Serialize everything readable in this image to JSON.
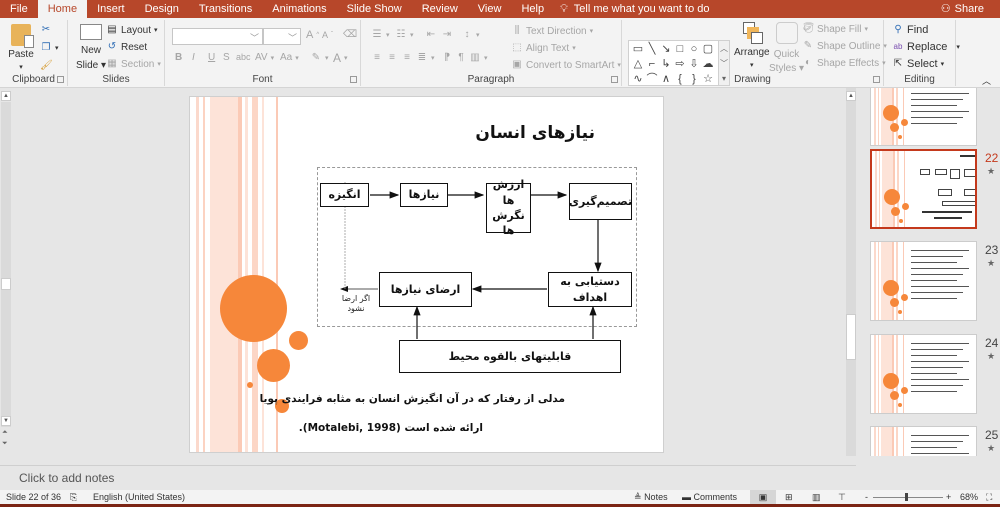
{
  "tabs": [
    "File",
    "Home",
    "Insert",
    "Design",
    "Transitions",
    "Animations",
    "Slide Show",
    "Review",
    "View",
    "Help"
  ],
  "active_tab": "Home",
  "tell_me": "Tell me what you want to do",
  "share": "Share",
  "ribbon": {
    "clipboard": {
      "label": "Clipboard",
      "paste": "Paste"
    },
    "slides": {
      "label": "Slides",
      "new_slide_1": "New",
      "new_slide_2": "Slide",
      "layout": "Layout",
      "reset": "Reset",
      "section": "Section"
    },
    "font": {
      "label": "Font",
      "font_name": "",
      "font_size": "",
      "bold": "B",
      "italic": "I",
      "underline": "U",
      "strike": "S",
      "abc": "abc",
      "spacing": "AV",
      "case": "Aa",
      "grow": "A",
      "shrink": "A",
      "color": "A"
    },
    "paragraph": {
      "label": "Paragraph",
      "text_direction": "Text Direction",
      "align_text": "Align Text",
      "convert_smartart": "Convert to SmartArt"
    },
    "drawing": {
      "label": "Drawing",
      "arrange": "Arrange",
      "quick_styles_1": "Quick",
      "quick_styles_2": "Styles",
      "shape_fill": "Shape Fill",
      "shape_outline": "Shape Outline",
      "shape_effects": "Shape Effects",
      "shapes": [
        "▭",
        "╲",
        "↘",
        "□",
        "○",
        "▢",
        "△",
        "⌐",
        "↳",
        "⇨",
        "⇩",
        "☁",
        "∿",
        "⌒",
        "∧",
        "{",
        "}",
        "☆"
      ]
    },
    "editing": {
      "label": "Editing",
      "find": "Find",
      "replace": "Replace",
      "select": "Select"
    }
  },
  "slide": {
    "title": "نیازهای انسان",
    "boxes": {
      "b1": "انگیزه",
      "b2": "نیازها",
      "b3_1": "ارزش ها",
      "b3_2": "نگرش ها",
      "b4": "تصمیم‌گیری",
      "b5": "دستیابی به اهداف",
      "b6": "ارضای نیازها",
      "b7": "قابلیتهای بالقوه محیط"
    },
    "feedback_label_1": "اگر ارضا",
    "feedback_label_2": "نشود",
    "caption_1": "مدلی از رفتار که در آن انگیزش انسان به مثابه فرایندی پویا",
    "caption_2": "ارائه شده است (Motalebi, 1998)."
  },
  "thumbnails": [
    {
      "number": "",
      "selected": false
    },
    {
      "number": "22",
      "selected": true
    },
    {
      "number": "23",
      "selected": false
    },
    {
      "number": "24",
      "selected": false
    },
    {
      "number": "25",
      "selected": false
    }
  ],
  "notes_placeholder": "Click to add notes",
  "status": {
    "slide_counter": "Slide 22 of 36",
    "language": "English (United States)",
    "notes": "Notes",
    "comments": "Comments",
    "zoom_minus": "-",
    "zoom_plus": "+",
    "zoom": "68%"
  },
  "colors": {
    "accent": "#b7472a",
    "orange": "#f6873a",
    "selected_thumb": "#c4391c"
  }
}
